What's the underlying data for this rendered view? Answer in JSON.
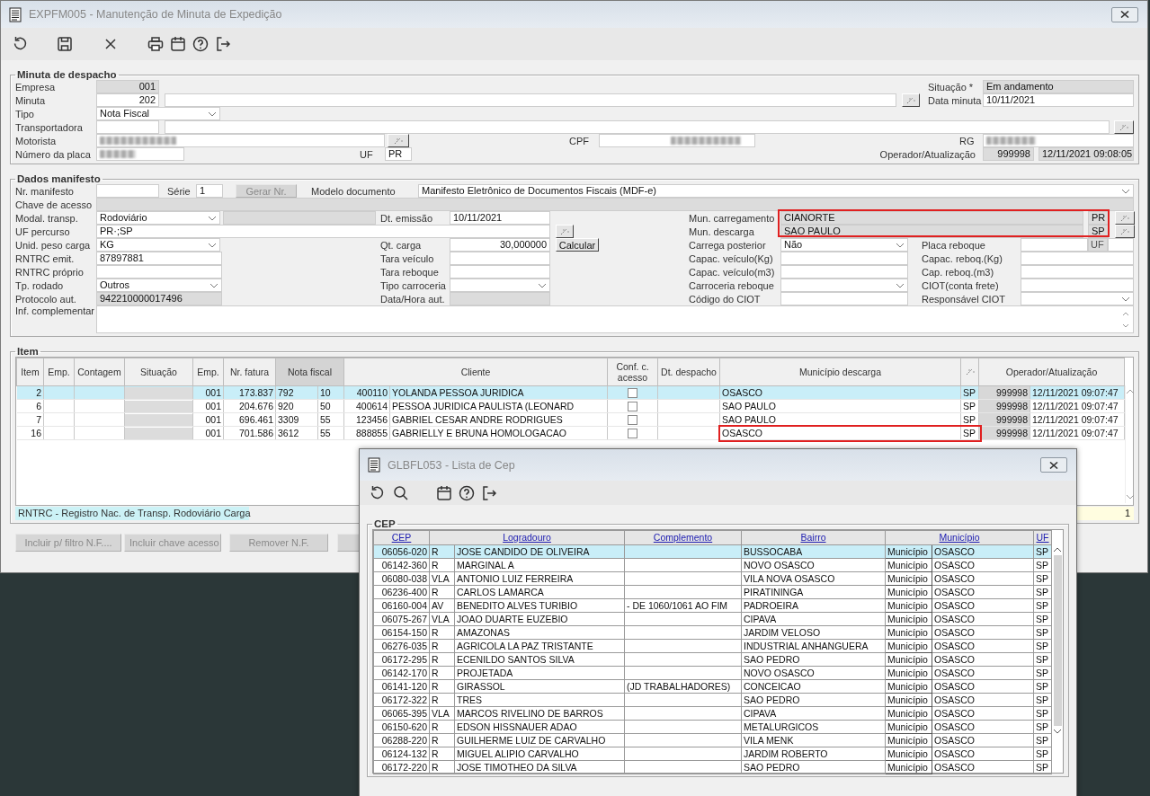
{
  "window": {
    "title": "EXPFM005 - Manutenção de Minuta de Expedição"
  },
  "minuta": {
    "legend": "Minuta de despacho",
    "empresa": {
      "label": "Empresa",
      "value": "001"
    },
    "situacao": {
      "label": "Situação *",
      "value": "Em andamento"
    },
    "minuta": {
      "label": "Minuta",
      "value": "202"
    },
    "data_minuta": {
      "label": "Data minuta",
      "value": "10/11/2021"
    },
    "tipo": {
      "label": "Tipo",
      "value": "Nota Fiscal"
    },
    "transportadora": {
      "label": "Transportadora"
    },
    "motorista": {
      "label": "Motorista"
    },
    "cpf": {
      "label": "CPF"
    },
    "rg": {
      "label": "RG"
    },
    "placa": {
      "label": "Número da placa"
    },
    "uf": {
      "label": "UF",
      "value": "PR"
    },
    "operador": {
      "label": "Operador/Atualização",
      "code": "999998",
      "datetime": "12/11/2021 09:08:05"
    }
  },
  "manifesto": {
    "legend": "Dados manifesto",
    "nr_manifesto": {
      "label": "Nr. manifesto"
    },
    "serie": {
      "label": "Série",
      "value": "1"
    },
    "gerar": {
      "label": "Gerar Nr.",
      "disabled": true
    },
    "modelo": {
      "label": "Modelo documento",
      "value": "Manifesto Eletrônico de Documentos Fiscais (MDF-e)"
    },
    "chave": {
      "label": "Chave de acesso"
    },
    "modal": {
      "label": "Modal. transp.",
      "value": "Rodoviário"
    },
    "dt_emissao": {
      "label": "Dt. emissão",
      "value": "10/11/2021"
    },
    "mun_carregamento": {
      "label": "Mun. carregamento",
      "value": "CIANORTE",
      "uf": "PR"
    },
    "uf_percurso": {
      "label": "UF percurso",
      "value": "PR·;SP"
    },
    "mun_descarga": {
      "label": "Mun. descarga",
      "value": "SAO PAULO",
      "uf": "SP"
    },
    "municipios_highlighted": true,
    "unid_peso": {
      "label": "Unid. peso carga",
      "value": "KG"
    },
    "qt_carga": {
      "label": "Qt. carga",
      "value": "30,000000"
    },
    "calcular": {
      "label": "Calcular",
      "disabled": false
    },
    "carrega_posterior": {
      "label": "Carrega posterior",
      "value": "Não"
    },
    "placa_reboque": {
      "label": "Placa reboque",
      "uf_label": "UF"
    },
    "rows": [
      [
        {
          "label": "RNTRC emit.",
          "kind": "text",
          "value": "87897881"
        },
        {
          "label": "Tara veículo",
          "kind": "text"
        },
        {
          "label": "Capac. veículo(Kg)",
          "kind": "text"
        },
        {
          "label": "Capac. reboq.(Kg)",
          "kind": "text"
        }
      ],
      [
        {
          "label": "RNTRC próprio",
          "kind": "text"
        },
        {
          "label": "Tara reboque",
          "kind": "text"
        },
        {
          "label": "Capac. veículo(m3)",
          "kind": "text"
        },
        {
          "label": "Cap. reboq.(m3)",
          "kind": "text"
        }
      ],
      [
        {
          "label": "Tp. rodado",
          "kind": "select",
          "value": "Outros"
        },
        {
          "label": "Tipo carroceria",
          "kind": "select"
        },
        {
          "label": "Carroceria reboque",
          "kind": "select"
        },
        {
          "label": "CIOT(conta frete)",
          "kind": "text"
        }
      ],
      [
        {
          "label": "Protocolo aut.",
          "kind": "readonly",
          "value": "942210000017496"
        },
        {
          "label": "Data/Hora aut.",
          "kind": "readonly"
        },
        {
          "label": "Código do CIOT",
          "kind": "text"
        },
        {
          "label": "Responsável CIOT",
          "kind": "select"
        }
      ]
    ],
    "inf_complementar": {
      "label": "Inf. complementar"
    }
  },
  "items": {
    "legend": "Item",
    "headers": [
      {
        "kind": "text",
        "label": "Item",
        "sorted": false
      },
      {
        "kind": "text",
        "label": "Emp.",
        "sorted": false
      },
      {
        "kind": "text",
        "label": "Contagem",
        "sorted": false
      },
      {
        "kind": "text",
        "label": "Situação",
        "sorted": false
      },
      {
        "kind": "text",
        "label": "Emp.",
        "sorted": false
      },
      {
        "kind": "text",
        "label": "Nr. fatura",
        "sorted": false
      },
      {
        "kind": "text",
        "label": "Nota fiscal",
        "sorted": true
      },
      {
        "kind": "text",
        "label": "Cliente",
        "sorted": false
      },
      {
        "kind": "text",
        "label": "Conf. c. acesso",
        "sorted": false
      },
      {
        "kind": "text",
        "label": "Dt. despacho",
        "sorted": false
      },
      {
        "kind": "text",
        "label": "Município descarga",
        "sorted": false
      },
      {
        "kind": "icon",
        "sorted": false
      },
      {
        "kind": "text",
        "label": "Operador/Atualização",
        "sorted": false
      }
    ],
    "rows": [
      {
        "item": "2",
        "empresa": "001",
        "nr_fatura": "173.837",
        "nf_numero": "792",
        "nf_serie": "10",
        "cliente_codigo": "400110",
        "cliente_nome": "YOLANDA PESSOA JURIDICA",
        "conf_acesso": false,
        "municipio": "OSASCO",
        "uf": "SP",
        "operador": "999998",
        "atualizacao": "12/11/2021 09:07:47",
        "selected": true,
        "highlighted": false
      },
      {
        "item": "6",
        "empresa": "001",
        "nr_fatura": "204.676",
        "nf_numero": "920",
        "nf_serie": "50",
        "cliente_codigo": "400614",
        "cliente_nome": "PESSOA JURIDICA PAULISTA (LEONARD",
        "conf_acesso": false,
        "municipio": "SAO PAULO",
        "uf": "SP",
        "operador": "999998",
        "atualizacao": "12/11/2021 09:07:47",
        "selected": false,
        "highlighted": false
      },
      {
        "item": "7",
        "empresa": "001",
        "nr_fatura": "696.461",
        "nf_numero": "3309",
        "nf_serie": "55",
        "cliente_codigo": "123456",
        "cliente_nome": "GABRIEL CESAR ANDRE RODRIGUES",
        "conf_acesso": false,
        "municipio": "SAO PAULO",
        "uf": "SP",
        "operador": "999998",
        "atualizacao": "12/11/2021 09:07:47",
        "selected": false,
        "highlighted": false
      },
      {
        "item": "16",
        "empresa": "001",
        "nr_fatura": "701.586",
        "nf_numero": "3612",
        "nf_serie": "55",
        "cliente_codigo": "888855",
        "cliente_nome": "GABRIELLY E BRUNA HOMOLOGACAO",
        "conf_acesso": false,
        "municipio": "OSASCO",
        "uf": "SP",
        "operador": "999998",
        "atualizacao": "12/11/2021 09:07:47",
        "selected": false,
        "highlighted": true
      }
    ],
    "status": "RNTRC - Registro Nac. de Transp. Rodoviário Carga",
    "count": "1"
  },
  "buttons": [
    {
      "label": "Incluir p/ filtro N.F....",
      "disabled": true
    },
    {
      "label": "Incluir chave acesso",
      "disabled": true
    },
    {
      "label": "Remover N.F.",
      "disabled": true
    }
  ],
  "dialog": {
    "title": "GLBFL053 - Lista de Cep",
    "legend": "CEP",
    "columns": [
      "CEP",
      "Logradouro",
      "Complemento",
      "Bairro",
      "Município",
      "UF"
    ],
    "rows": [
      {
        "cep": "06056-020",
        "tipo": "R",
        "logradouro": "JOSE CANDIDO DE OLIVEIRA",
        "bairro": "BUSSOCABA",
        "municipio_label": "Município",
        "municipio": "OSASCO",
        "uf": "SP",
        "selected": true
      },
      {
        "cep": "06142-360",
        "tipo": "R",
        "logradouro": "MARGINAL A",
        "bairro": "NOVO OSASCO",
        "municipio_label": "Município",
        "municipio": "OSASCO",
        "uf": "SP",
        "selected": false
      },
      {
        "cep": "06080-038",
        "tipo": "VLA",
        "logradouro": "ANTONIO LUIZ FERREIRA",
        "bairro": "VILA NOVA OSASCO",
        "municipio_label": "Município",
        "municipio": "OSASCO",
        "uf": "SP",
        "selected": false
      },
      {
        "cep": "06236-400",
        "tipo": "R",
        "logradouro": "CARLOS LAMARCA",
        "bairro": "PIRATININGA",
        "municipio_label": "Município",
        "municipio": "OSASCO",
        "uf": "SP",
        "selected": false
      },
      {
        "cep": "06160-004",
        "tipo": "AV",
        "logradouro": "BENEDITO ALVES TURIBIO",
        "complemento": "- DE 1060/1061 AO FIM",
        "bairro": "PADROEIRA",
        "municipio_label": "Município",
        "municipio": "OSASCO",
        "uf": "SP",
        "selected": false
      },
      {
        "cep": "06075-267",
        "tipo": "VLA",
        "logradouro": "JOAO DUARTE EUZEBIO",
        "bairro": "CIPAVA",
        "municipio_label": "Município",
        "municipio": "OSASCO",
        "uf": "SP",
        "selected": false
      },
      {
        "cep": "06154-150",
        "tipo": "R",
        "logradouro": "AMAZONAS",
        "bairro": "JARDIM VELOSO",
        "municipio_label": "Município",
        "municipio": "OSASCO",
        "uf": "SP",
        "selected": false
      },
      {
        "cep": "06276-035",
        "tipo": "R",
        "logradouro": "AGRICOLA LA PAZ TRISTANTE",
        "bairro": "INDUSTRIAL ANHANGUERA",
        "municipio_label": "Município",
        "municipio": "OSASCO",
        "uf": "SP",
        "selected": false
      },
      {
        "cep": "06172-295",
        "tipo": "R",
        "logradouro": "ECENILDO SANTOS SILVA",
        "bairro": "SAO PEDRO",
        "municipio_label": "Município",
        "municipio": "OSASCO",
        "uf": "SP",
        "selected": false
      },
      {
        "cep": "06142-170",
        "tipo": "R",
        "logradouro": "PROJETADA",
        "bairro": "NOVO OSASCO",
        "municipio_label": "Município",
        "municipio": "OSASCO",
        "uf": "SP",
        "selected": false
      },
      {
        "cep": "06141-120",
        "tipo": "R",
        "logradouro": "GIRASSOL",
        "complemento": "(JD TRABALHADORES)",
        "bairro": "CONCEICAO",
        "municipio_label": "Município",
        "municipio": "OSASCO",
        "uf": "SP",
        "selected": false
      },
      {
        "cep": "06172-322",
        "tipo": "R",
        "logradouro": "TRES",
        "bairro": "SAO PEDRO",
        "municipio_label": "Município",
        "municipio": "OSASCO",
        "uf": "SP",
        "selected": false
      },
      {
        "cep": "06065-395",
        "tipo": "VLA",
        "logradouro": "MARCOS RIVELINO DE BARROS",
        "bairro": "CIPAVA",
        "municipio_label": "Município",
        "municipio": "OSASCO",
        "uf": "SP",
        "selected": false
      },
      {
        "cep": "06150-620",
        "tipo": "R",
        "logradouro": "EDSON HISSNAUER ADAO",
        "bairro": "METALURGICOS",
        "municipio_label": "Município",
        "municipio": "OSASCO",
        "uf": "SP",
        "selected": false
      },
      {
        "cep": "06288-220",
        "tipo": "R",
        "logradouro": "GUILHERME LUIZ DE CARVALHO",
        "bairro": "VILA MENK",
        "municipio_label": "Município",
        "municipio": "OSASCO",
        "uf": "SP",
        "selected": false
      },
      {
        "cep": "06124-132",
        "tipo": "R",
        "logradouro": "MIGUEL ALIPIO CARVALHO",
        "bairro": "JARDIM ROBERTO",
        "municipio_label": "Município",
        "municipio": "OSASCO",
        "uf": "SP",
        "selected": false
      },
      {
        "cep": "06172-220",
        "tipo": "R",
        "logradouro": "JOSE TIMOTHEO DA SILVA",
        "bairro": "SAO PEDRO",
        "municipio_label": "Município",
        "municipio": "OSASCO",
        "uf": "SP",
        "selected": false
      }
    ]
  }
}
